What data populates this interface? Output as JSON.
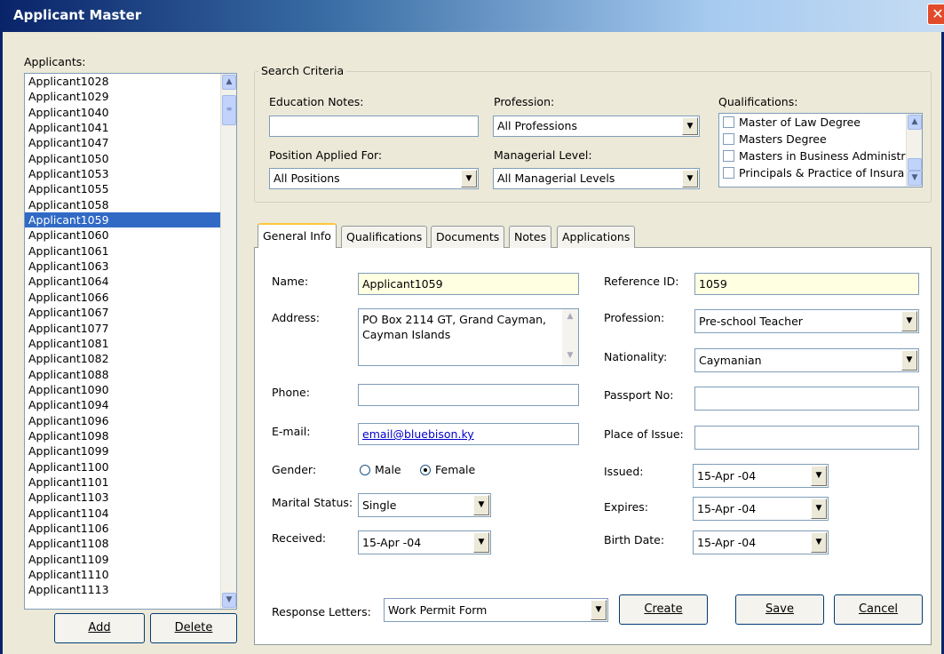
{
  "window": {
    "title": "Applicant Master",
    "close_glyph": "✕"
  },
  "applicants": {
    "label": "Applicants:",
    "items": [
      "Applicant1028",
      "Applicant1029",
      "Applicant1040",
      "Applicant1041",
      "Applicant1047",
      "Applicant1050",
      "Applicant1053",
      "Applicant1055",
      "Applicant1058",
      "Applicant1059",
      "Applicant1060",
      "Applicant1061",
      "Applicant1063",
      "Applicant1064",
      "Applicant1066",
      "Applicant1067",
      "Applicant1077",
      "Applicant1081",
      "Applicant1082",
      "Applicant1088",
      "Applicant1090",
      "Applicant1094",
      "Applicant1096",
      "Applicant1098",
      "Applicant1099",
      "Applicant1100",
      "Applicant1101",
      "Applicant1103",
      "Applicant1104",
      "Applicant1106",
      "Applicant1108",
      "Applicant1109",
      "Applicant1110",
      "Applicant1113"
    ],
    "selected": "Applicant1059",
    "add_label": "Add",
    "delete_label": "Delete"
  },
  "search": {
    "title": "Search Criteria",
    "education_notes_label": "Education Notes:",
    "education_notes_value": "",
    "profession_label": "Profession:",
    "profession_value": "All Professions",
    "qualifications_label": "Qualifications:",
    "qualifications": [
      "Master of Law Degree",
      "Masters Degree",
      "Masters in Business Administr",
      "Principals & Practice of Insura"
    ],
    "position_label": "Position Applied For:",
    "position_value": "All Positions",
    "managerial_label": "Managerial Level:",
    "managerial_value": "All Managerial Levels"
  },
  "tabs": [
    {
      "label": "General Info"
    },
    {
      "label": "Qualifications"
    },
    {
      "label": "Documents"
    },
    {
      "label": "Notes"
    },
    {
      "label": "Applications"
    }
  ],
  "general": {
    "name_label": "Name:",
    "name_value": "Applicant1059",
    "address_label": "Address:",
    "address_line1": "PO Box 2114 GT, Grand Cayman,",
    "address_line2": "Cayman Islands",
    "phone_label": "Phone:",
    "phone_value": "",
    "email_label": "E-mail:",
    "email_value": "email@bluebison.ky",
    "gender_label": "Gender:",
    "gender_male": "Male",
    "gender_female": "Female",
    "gender_selected": "Female",
    "marital_label": "Marital Status:",
    "marital_value": "Single",
    "received_label": "Received:",
    "received_value": "15-Apr -04",
    "refid_label": "Reference ID:",
    "refid_value": "1059",
    "profession_label": "Profession:",
    "profession_value": "Pre-school Teacher",
    "nationality_label": "Nationality:",
    "nationality_value": "Caymanian",
    "passport_label": "Passport No:",
    "passport_value": "",
    "place_label": "Place of Issue:",
    "place_value": "",
    "issued_label": "Issued:",
    "issued_value": "15-Apr -04",
    "expires_label": "Expires:",
    "expires_value": "15-Apr -04",
    "birth_label": "Birth Date:",
    "birth_value": "15-Apr -04"
  },
  "footer": {
    "response_label": "Response Letters:",
    "response_value": "Work Permit Form",
    "create_label": "Create",
    "save_label": "Save",
    "cancel_label": "Cancel"
  },
  "icons": {
    "dropdown": "▼",
    "scroll_up": "▲",
    "scroll_down": "▼",
    "grip": "≡"
  }
}
